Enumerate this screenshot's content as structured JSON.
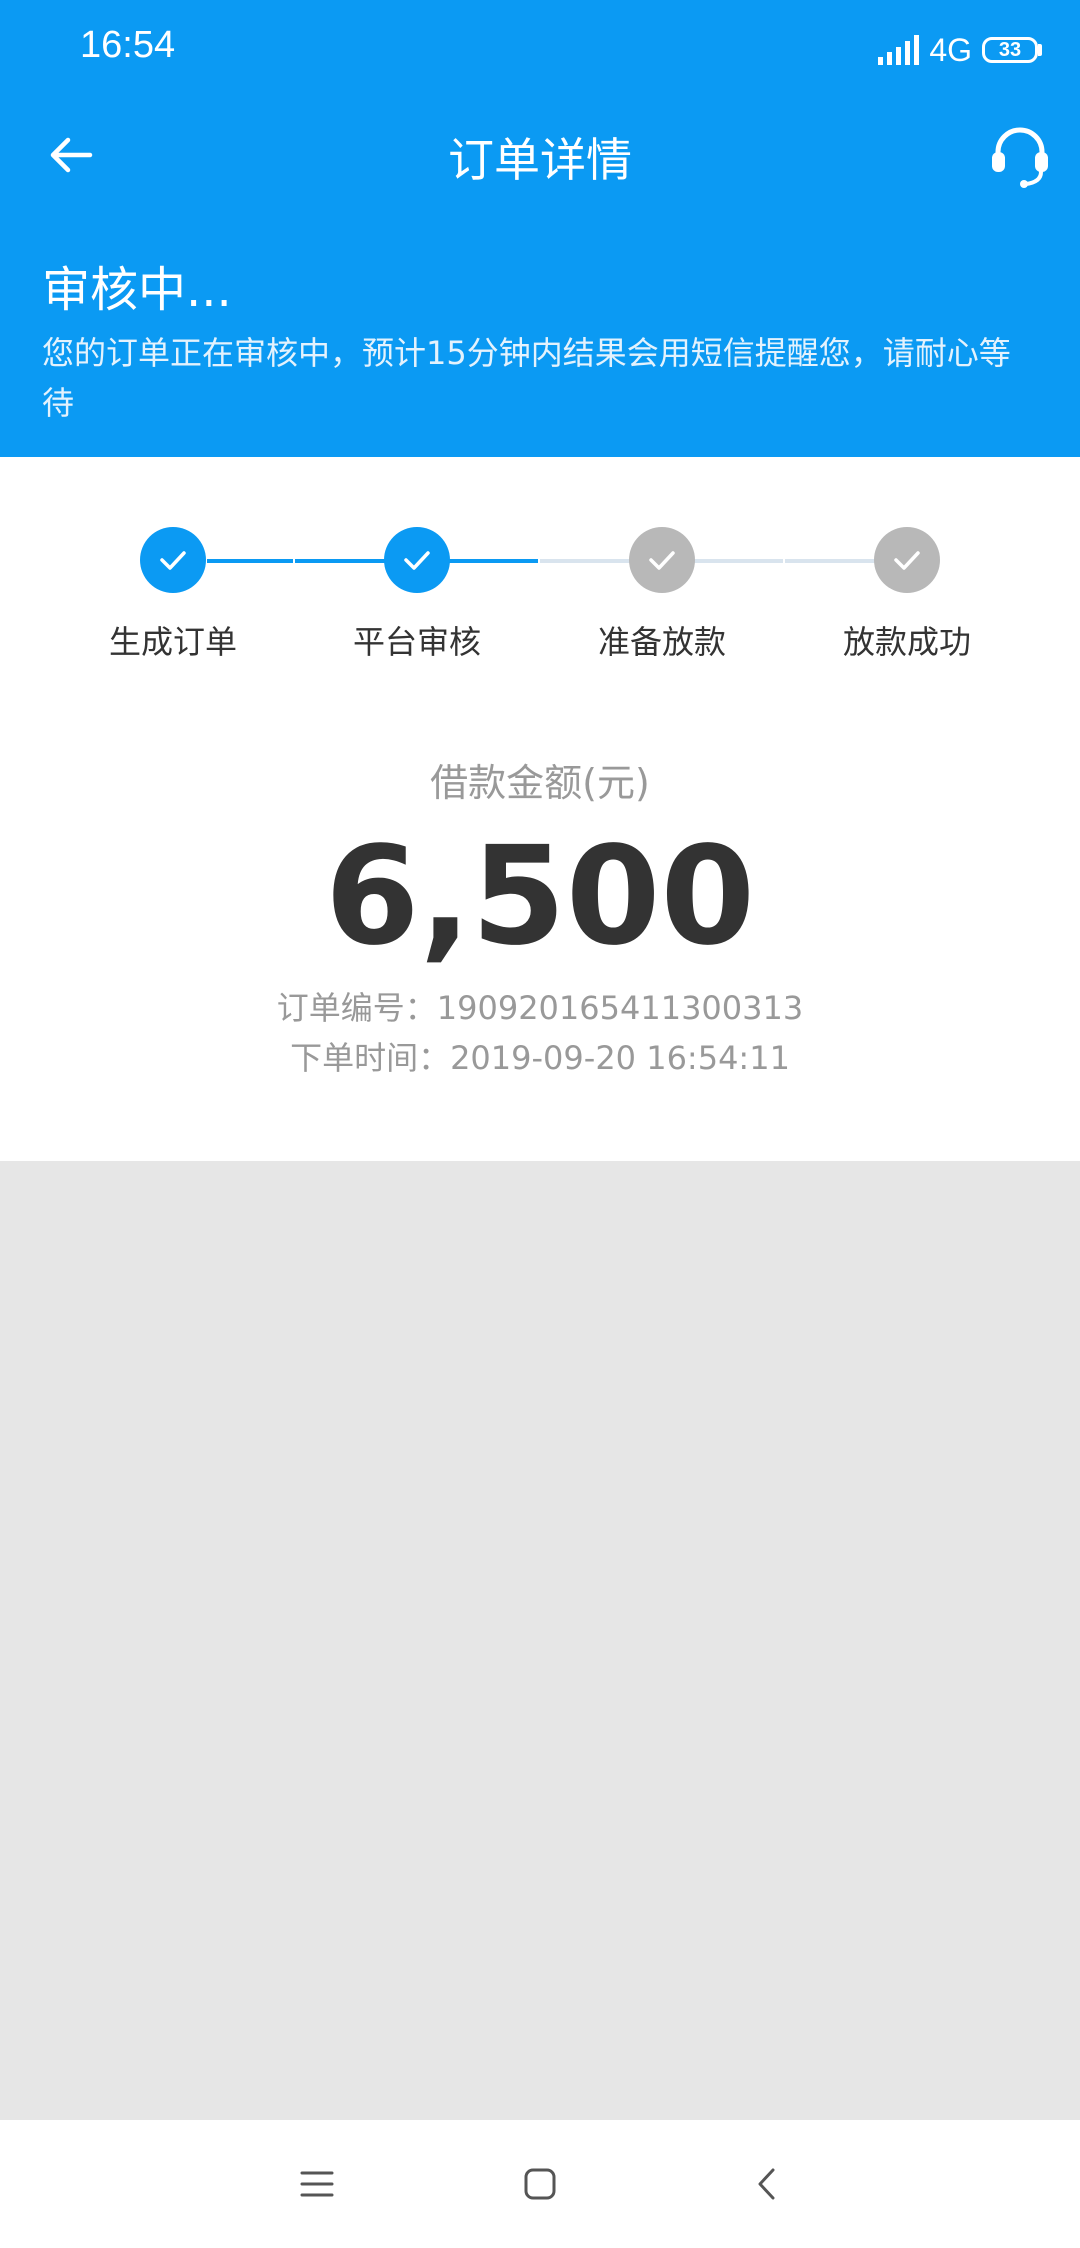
{
  "status_bar": {
    "time": "16:54",
    "network": "4G",
    "battery": "33"
  },
  "header": {
    "title": "订单详情",
    "back_icon": "arrow-left-icon",
    "service_icon": "headset-icon"
  },
  "review": {
    "title": "审核中...",
    "description": "您的订单正在审核中，预计15分钟内结果会用短信提醒您，请耐心等待"
  },
  "steps": [
    {
      "label": "生成订单",
      "done": true
    },
    {
      "label": "平台审核",
      "done": true
    },
    {
      "label": "准备放款",
      "done": false
    },
    {
      "label": "放款成功",
      "done": false
    }
  ],
  "loan": {
    "amount_label": "借款金额(元)",
    "amount": "6,500",
    "order_no": "订单编号：1909201654113003​13",
    "order_time": "下单时间：2019-09-20 16:54:11"
  },
  "colors": {
    "primary": "#0b9af3",
    "step_done": "#0b9af3",
    "step_pending": "#b8b8b8",
    "line_pending": "#d9e4ee"
  },
  "system_nav": {
    "menu_icon": "menu-icon",
    "home_icon": "home-square-icon",
    "back_icon": "chevron-left-icon"
  }
}
